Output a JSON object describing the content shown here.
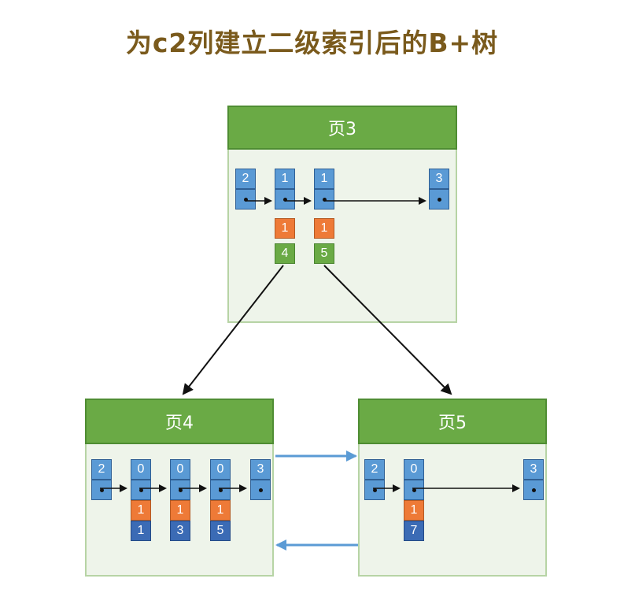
{
  "title": "为c2列建立二级索引后的B+树",
  "pages": {
    "p3": {
      "label": "页3",
      "records": [
        {
          "key": "2",
          "c2": null,
          "ref": null
        },
        {
          "key": "1",
          "c2": "1",
          "ref": "4"
        },
        {
          "key": "1",
          "c2": "1",
          "ref": "5"
        },
        {
          "key": "3",
          "c2": null,
          "ref": null
        }
      ]
    },
    "p4": {
      "label": "页4",
      "records": [
        {
          "key": "2",
          "c2": null,
          "ref": null
        },
        {
          "key": "0",
          "c2": "1",
          "ref": "1"
        },
        {
          "key": "0",
          "c2": "1",
          "ref": "3"
        },
        {
          "key": "0",
          "c2": "1",
          "ref": "5"
        },
        {
          "key": "3",
          "c2": null,
          "ref": null
        }
      ]
    },
    "p5": {
      "label": "页5",
      "records": [
        {
          "key": "2",
          "c2": null,
          "ref": null
        },
        {
          "key": "0",
          "c2": "1",
          "ref": "7"
        },
        {
          "key": "3",
          "c2": null,
          "ref": null
        }
      ]
    }
  },
  "colors": {
    "title": "#7a5a1c",
    "header": "#6aaa45",
    "page_bg": "#eef4ea",
    "key_cell": "#5a9ad5",
    "c2_cell": "#ee7a37",
    "page_ref_cell": "#6aaa45",
    "pk_cell": "#3b6bb5",
    "sibling_arrow": "#5b9bd5"
  }
}
